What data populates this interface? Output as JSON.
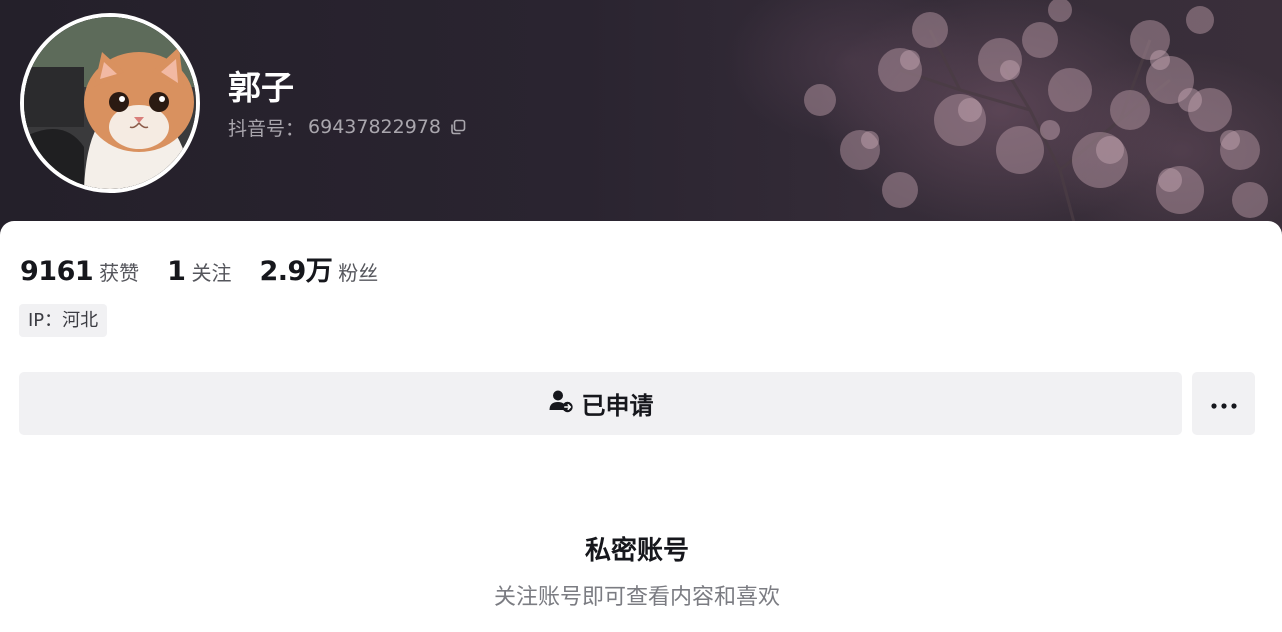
{
  "profile": {
    "nickname": "郭子",
    "douyin_id_label": "抖音号：",
    "douyin_id": "69437822978"
  },
  "stats": [
    {
      "value": "9161",
      "label": "获赞"
    },
    {
      "value": "1",
      "label": "关注"
    },
    {
      "value": "2.9万",
      "label": "粉丝"
    }
  ],
  "ip_tag": "IP：河北",
  "actions": {
    "applied_label": "已申请",
    "applied_icon": "user-pending-icon",
    "more_icon": "more-dots-icon"
  },
  "private_notice": {
    "title": "私密账号",
    "description": "关注账号即可查看内容和喜欢"
  },
  "colors": {
    "header_bg": "#2a2430",
    "button_bg": "#f1f1f3",
    "text_primary": "#16171c",
    "text_secondary": "#7b7c82"
  }
}
